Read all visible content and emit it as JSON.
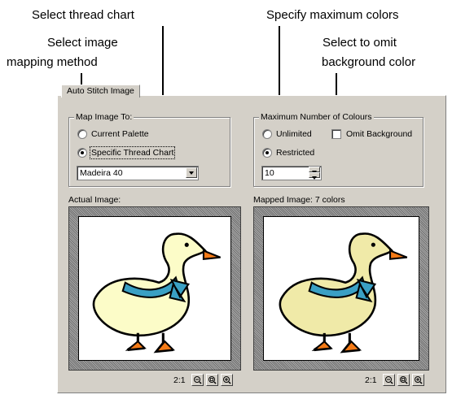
{
  "callouts": {
    "thread_chart": "Select thread chart",
    "mapping_method_1": "Select image",
    "mapping_method_2": "mapping method",
    "max_colors": "Specify maximum colors",
    "omit_bg_1": "Select to omit",
    "omit_bg_2": "background color"
  },
  "dialog": {
    "tab": "Auto Stitch Image",
    "map_group": {
      "label": "Map Image To:",
      "current_palette": "Current Palette",
      "specific_chart": "Specific Thread Chart",
      "selected_option": "specific_chart",
      "chart_value": "Madeira 40"
    },
    "colours_group": {
      "label": "Maximum Number of Colours",
      "unlimited": "Unlimited",
      "restricted": "Restricted",
      "selected_option": "restricted",
      "omit_background": "Omit Background",
      "omit_checked": false,
      "count_value": "10"
    },
    "actual": {
      "label": "Actual Image:",
      "zoom_ratio": "2:1"
    },
    "mapped": {
      "label": "Mapped Image: 7 colors",
      "zoom_ratio": "2:1"
    }
  },
  "icons": [
    "zoom-out-icon",
    "zoom-fit-icon",
    "zoom-in-icon",
    "duck-image"
  ],
  "colors": {
    "duck_body_actual": "#fcfcc8",
    "duck_body_mapped": "#f0eaa8",
    "ribbon": "#3aa0c4",
    "beak_feet": "#f47a16"
  }
}
